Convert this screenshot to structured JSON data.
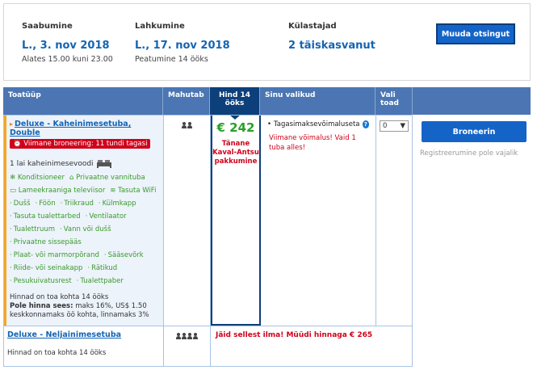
{
  "summary": {
    "checkin": {
      "label": "Saabumine",
      "date": "L., 3. nov 2018",
      "note": "Alates 15.00 kuni 23.00"
    },
    "checkout": {
      "label": "Lahkumine",
      "date": "L., 17. nov 2018",
      "note": "Peatumine 14 ööks"
    },
    "guests": {
      "label": "Külastajad",
      "value": "2 täiskasvanut"
    },
    "change_button": "Muuda otsingut"
  },
  "table": {
    "headers": {
      "room_type": "Toatüüp",
      "capacity": "Mahutab",
      "price": "Hind 14 ööks",
      "choices": "Sinu valikud",
      "select": "Vali toad"
    },
    "rooms": [
      {
        "name": "Deluxe - Kaheinimesetuba, Double",
        "urgency": "Viimane broneering: 11 tundi tagasi",
        "bed": "1 lai kaheinimesevoodi",
        "amenities_icons": [
          "Konditsioneer",
          "Privaatne vannituba",
          "Lameekraaniga televiisor",
          "Tasuta WiFi"
        ],
        "amenities": [
          [
            "Dušš",
            "Föön",
            "Triikraud",
            "Külmkapp"
          ],
          [
            "Tasuta tualettarbed",
            "Ventilaator"
          ],
          [
            "Tualettruum",
            "Vann või dušš"
          ],
          [
            "Privaatne sissepääs"
          ],
          [
            "Plaat- või marmorpõrand",
            "Sääsevõrk"
          ],
          [
            "Riide- või seinakapp",
            "Rätikud"
          ],
          [
            "Pesukuivatusrest",
            "Tualettpaber"
          ]
        ],
        "price_note": "Hinnad on toa kohta 14 ööks",
        "price_includes_label": "Pole hinna sees:",
        "price_includes_text": "maks 16%, US$ 1.50 keskkonnamaks öö kohta, linnamaks 3%",
        "price": "€ 242",
        "deal": "Tänane Kaval-Antsu pakkumine",
        "choice": "Tagasimaksevõimaluseta",
        "warning": "Viimane võimalus! Vaid 1 tuba alles!",
        "qty": "0"
      },
      {
        "name": "Deluxe - Neljainimesetuba",
        "price_note": "Hinnad on toa kohta 14 ööks",
        "missed": "Jäid sellest ilma! Müüdi hinnaga € 265"
      }
    ]
  },
  "side": {
    "book_button": "Broneerin",
    "no_registration": "Registreerumine pole vajalik"
  },
  "colors": {
    "accent": "#1464c8",
    "price_green": "#27a127",
    "alert_red": "#d0021b",
    "header_blue": "#4b76b3"
  }
}
